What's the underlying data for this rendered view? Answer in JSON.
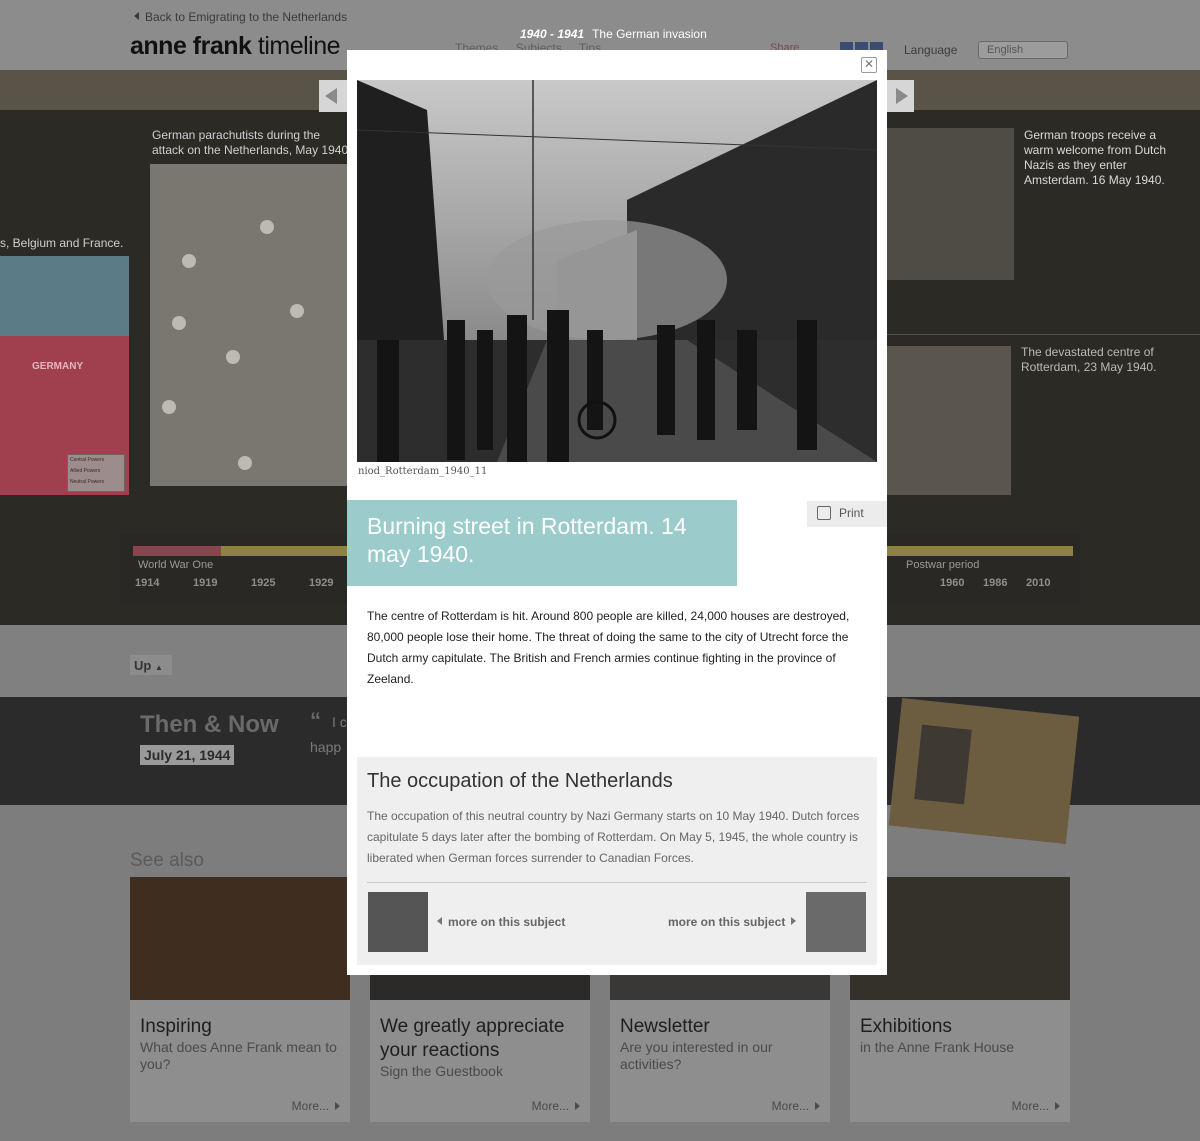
{
  "header": {
    "back_link": "Back to Emigrating to the Netherlands",
    "logo_bold": "anne frank",
    "logo_light": "timeline",
    "nav": [
      "Themes",
      "Subjects",
      "Tips"
    ],
    "share": "Share",
    "language_label": "Language",
    "language_value": "English"
  },
  "background": {
    "caption_left": "German parachutists during the attack on the Netherlands, May 1940.",
    "map_caption": "s, Belgium and France.",
    "map_label": "GERMANY",
    "legend": [
      "Central Powers",
      "Allied Powers",
      "Neutral Powers"
    ],
    "caption_right_1": "German troops receive a warm welcome from Dutch Nazis as they enter Amsterdam. 16 May 1940.",
    "caption_right_2": "The devastated centre of Rotterdam, 23 May 1940.",
    "timeline_left_label": "World War One",
    "timeline_left_years": [
      "1914",
      "1919",
      "1925",
      "1929"
    ],
    "timeline_right_label": "Postwar period",
    "timeline_right_years": [
      "1960",
      "1986",
      "2010"
    ],
    "up_label": "Up"
  },
  "then_now": {
    "title": "Then & Now",
    "date": "July 21, 1944",
    "quote_mark": "“",
    "quote_line1": "I c",
    "quote_line2": "happ"
  },
  "see_also": {
    "heading": "See also",
    "cards": [
      {
        "title": "Inspiring",
        "subtitle": "What does Anne Frank mean to you?",
        "more": "More..."
      },
      {
        "title": "We greatly appreciate your reactions",
        "subtitle": "Sign the Guestbook",
        "more": "More..."
      },
      {
        "title": "Newsletter",
        "subtitle": "Are you interested in our activities?",
        "more": "More..."
      },
      {
        "title": "Exhibitions",
        "subtitle": "in the Anne Frank House",
        "more": "More..."
      }
    ]
  },
  "modal": {
    "period": "1940 - 1941",
    "period_title": "The German invasion",
    "close_symbol": "✕",
    "photo_credit": "niod_Rotterdam_1940_11",
    "title": "Burning street in Rotterdam. 14 may 1940.",
    "print_label": "Print",
    "body": "The centre of Rotterdam is hit. Around 800 people are killed, 24,000 houses are destroyed, 80,000 people lose their home. The threat of doing the same to the city of Utrecht force the Dutch army capitulate. The British and French armies continue fighting in the province of Zeeland.",
    "subject_title": "The occupation of the Netherlands",
    "subject_body": "The occupation of this neutral country by Nazi Germany starts on 10 May 1940. Dutch forces capitulate 5 days later after the bombing of Rotterdam.  On May 5, 1945, the whole country is liberated when German forces surrender to Canadian Forces.",
    "more_prev": "more on this subject",
    "more_next": "more on this subject"
  },
  "colors": {
    "title_box": "#9ccbcc",
    "overlay": "#7d7d7d"
  }
}
